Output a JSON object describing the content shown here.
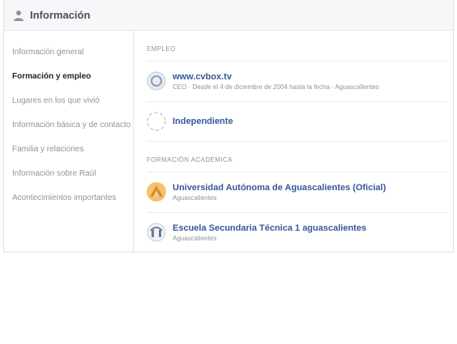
{
  "header": {
    "title": "Información",
    "icon": "person-icon"
  },
  "sidebar": {
    "items": [
      {
        "label": "Información general"
      },
      {
        "label": "Formación y empleo"
      },
      {
        "label": "Lugares en los que vivió"
      },
      {
        "label": "Información básica y de contacto"
      },
      {
        "label": "Familia y relaciones"
      },
      {
        "label": "Información sobre Raúl"
      },
      {
        "label": "Acontecimientos importantes"
      }
    ]
  },
  "employment": {
    "title": "EMPLEO",
    "entries": [
      {
        "name": "www.cvbox.tv",
        "meta": "CEO · Desde el 4 de diciembre de 2004 hasta la fecha · Aguascalientes"
      },
      {
        "name": "Independiente",
        "meta": ""
      }
    ]
  },
  "education": {
    "title": "FORMACIÓN ACADÉMICA",
    "entries": [
      {
        "name": "Universidad Autónoma de Aguascalientes (Oficial)",
        "meta": "Aguascalientes"
      },
      {
        "name": "Escuela Secundaria Técnica 1 aguascalientes",
        "meta": "Aguascalientes"
      }
    ]
  },
  "colors": {
    "link": "#365899",
    "muted": "#90949c",
    "header_bg": "#f6f7f9"
  }
}
